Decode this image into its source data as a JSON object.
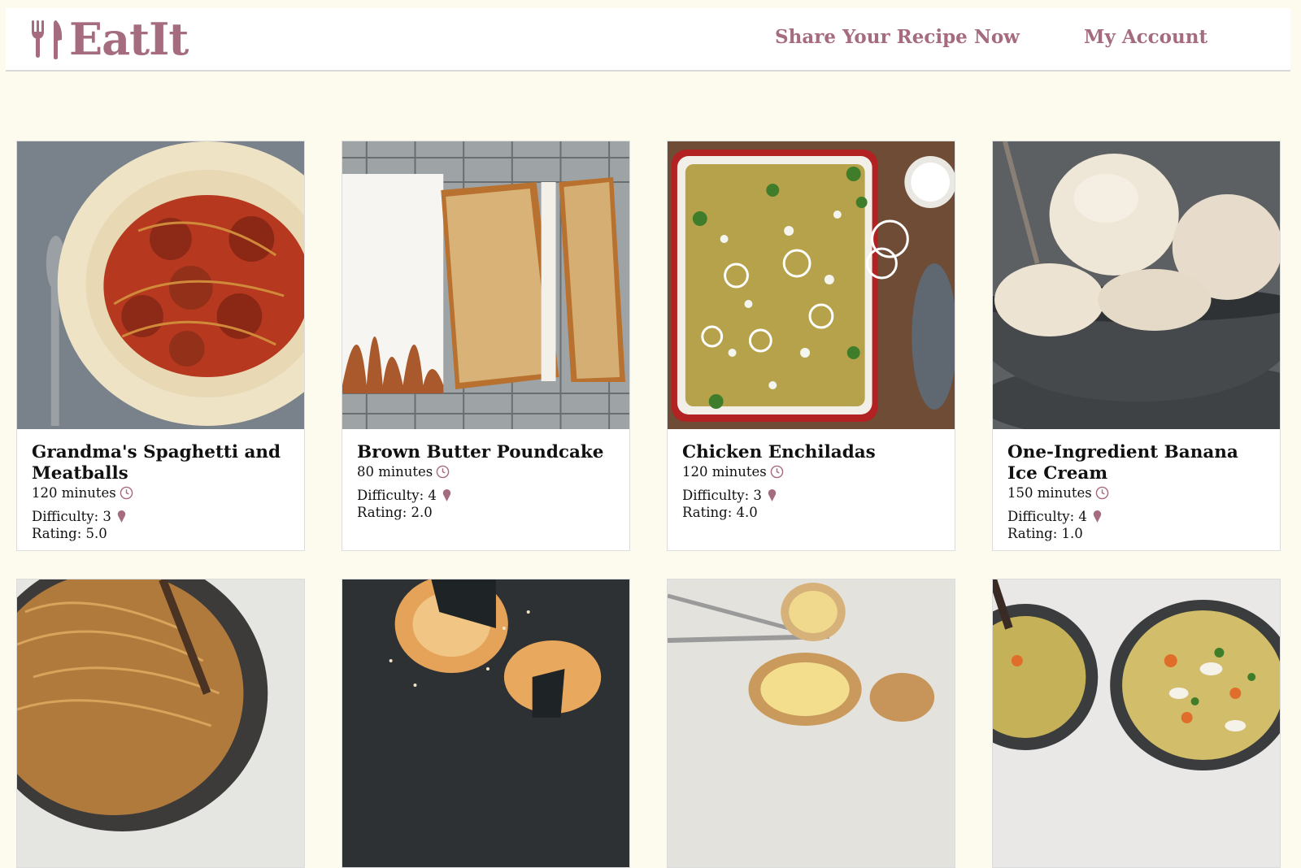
{
  "header": {
    "brand": "EatIt",
    "nav": {
      "share_label": "Share Your Recipe Now",
      "account_label": "My Account"
    }
  },
  "colors": {
    "accent": "#a56b7e",
    "background": "#fdfaee"
  },
  "icons": {
    "brand": "fork-knife-icon",
    "time": "clock-icon",
    "difficulty": "ice-cream-cone-icon"
  },
  "recipes": [
    {
      "title": "Grandma's Spaghetti and Meatballs",
      "time": "120 minutes",
      "difficulty": "Difficulty: 3",
      "rating": "Rating: 5.0",
      "photo": "spaghetti-meatballs"
    },
    {
      "title": "Brown Butter Poundcake",
      "time": "80 minutes",
      "difficulty": "Difficulty: 4",
      "rating": "Rating: 2.0",
      "photo": "poundcake"
    },
    {
      "title": "Chicken Enchiladas",
      "time": "120 minutes",
      "difficulty": "Difficulty: 3",
      "rating": "Rating: 4.0",
      "photo": "enchiladas"
    },
    {
      "title": "One-Ingredient Banana Ice Cream",
      "time": "150 minutes",
      "difficulty": "Difficulty: 4",
      "rating": "Rating: 1.0",
      "photo": "banana-ice-cream"
    },
    {
      "photo": "noodles"
    },
    {
      "photo": "rice-balls"
    },
    {
      "photo": "baked-potato"
    },
    {
      "photo": "soup"
    }
  ]
}
